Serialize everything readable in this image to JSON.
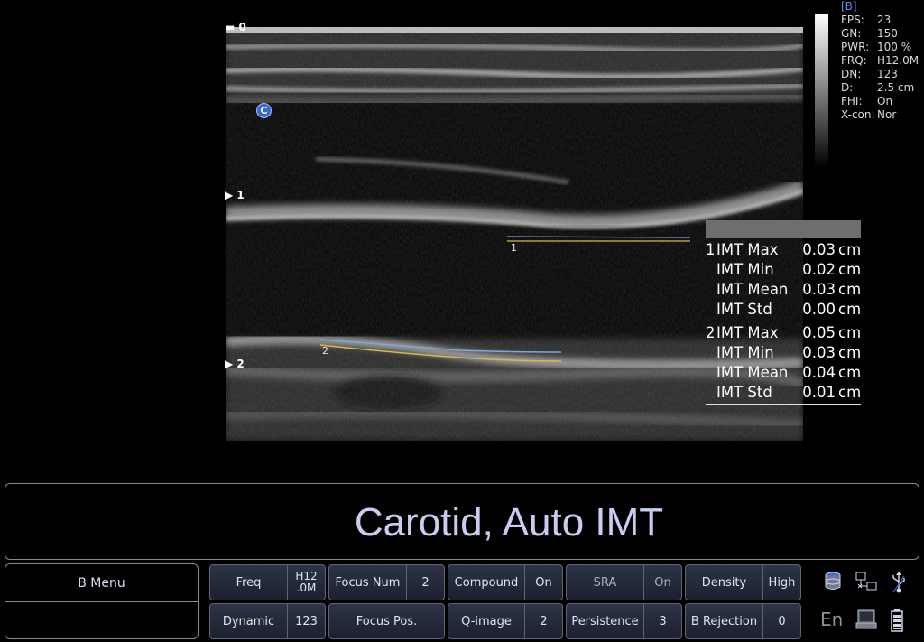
{
  "image": {
    "depth_marks": [
      "0",
      "1",
      "2"
    ],
    "body_marker": "C",
    "trace_labels": [
      "1",
      "2"
    ]
  },
  "params": {
    "mode": "[B]",
    "rows": [
      {
        "key": "FPS:",
        "value": "23"
      },
      {
        "key": "GN:",
        "value": "150"
      },
      {
        "key": "PWR:",
        "value": "100 %"
      },
      {
        "key": "FRQ:",
        "value": "H12.0M"
      },
      {
        "key": "DN:",
        "value": "123"
      },
      {
        "key": "D:",
        "value": "2.5 cm"
      },
      {
        "key": "FHI:",
        "value": "On"
      },
      {
        "key": "X-con:",
        "value": "Nor"
      }
    ]
  },
  "imt": [
    {
      "index": "1",
      "rows": [
        {
          "label": "IMT Max",
          "value": "0.03",
          "unit": "cm"
        },
        {
          "label": "IMT Min",
          "value": "0.02",
          "unit": "cm"
        },
        {
          "label": "IMT Mean",
          "value": "0.03",
          "unit": "cm"
        },
        {
          "label": "IMT Std",
          "value": "0.00",
          "unit": "cm"
        }
      ]
    },
    {
      "index": "2",
      "rows": [
        {
          "label": "IMT Max",
          "value": "0.05",
          "unit": "cm"
        },
        {
          "label": "IMT Min",
          "value": "0.03",
          "unit": "cm"
        },
        {
          "label": "IMT Mean",
          "value": "0.04",
          "unit": "cm"
        },
        {
          "label": "IMT Std",
          "value": "0.01",
          "unit": "cm"
        }
      ]
    }
  ],
  "label_bar": {
    "text": "Carotid, Auto IMT"
  },
  "menu": {
    "title": "B Menu"
  },
  "softkeys": {
    "freq": {
      "name": "Freq",
      "value_l1": "H12",
      "value_l2": ".0M"
    },
    "dynamic": {
      "name": "Dynamic",
      "value": "123"
    },
    "focus_num": {
      "name": "Focus Num",
      "value": "2"
    },
    "focus_pos": {
      "name": "Focus Pos."
    },
    "compound": {
      "name": "Compound",
      "value": "On"
    },
    "q_image": {
      "name": "Q-image",
      "value": "2"
    },
    "sra": {
      "name": "SRA",
      "value": "On"
    },
    "persistence": {
      "name": "Persistence",
      "value": "3"
    },
    "density": {
      "name": "Density",
      "value": "High"
    },
    "b_rejection": {
      "name": "B Rejection",
      "value": "0"
    }
  },
  "status": {
    "language": "En"
  },
  "colors": {
    "accent": "#5b8de8",
    "label_text": "#c8cdf0",
    "trace_yellow": "#d8b84a",
    "trace_blue": "#7fa8d8"
  }
}
